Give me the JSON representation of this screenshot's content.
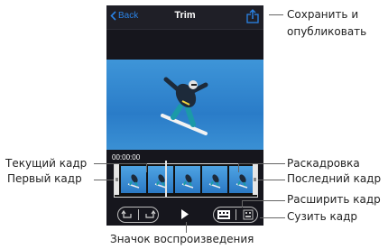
{
  "app": {
    "back_label": "Back",
    "title": "Trim",
    "timecode": "00:00:00"
  },
  "icons": {
    "back": "chevron-left-icon",
    "share": "share-icon",
    "play": "play-icon",
    "expand_frame": "film-expand-icon",
    "shrink_frame": "film-shrink-icon",
    "undo": "undo-icon",
    "redo": "redo-icon"
  },
  "callouts": {
    "save_publish_1": "Сохранить и",
    "save_publish_2": "опубликовать",
    "current_frame": "Текущий кадр",
    "first_frame": "Первый кадр",
    "storyboard": "Раскадровка",
    "last_frame": "Последний кадр",
    "expand_frame": "Расширить кадр",
    "shrink_frame": "Сузить кадр",
    "play_icon": "Значок воспроизведения"
  },
  "colors": {
    "accent": "#2a83e6",
    "phone_bg": "#16161d",
    "sky": "#3e95d8"
  }
}
